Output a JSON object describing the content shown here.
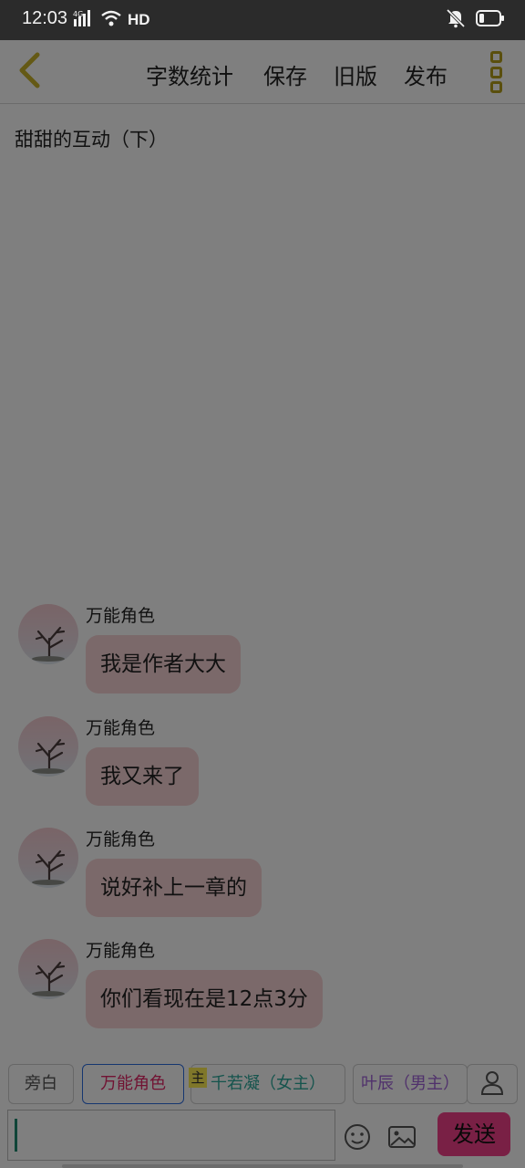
{
  "status_bar": {
    "time": "12:03",
    "network": "4G",
    "hd": "HD",
    "icons": [
      "signal-icon",
      "wifi-icon",
      "mute-icon",
      "battery-icon"
    ]
  },
  "toolbar": {
    "back_icon": "chevron-left-icon",
    "word_count": "字数统计",
    "save": "保存",
    "old_version": "旧版",
    "publish": "发布",
    "more_icon": "more-vertical-icon"
  },
  "chapter": {
    "title": "甜甜的互动（下）"
  },
  "messages": [
    {
      "sender": "万能角色",
      "text": "我是作者大大",
      "avatar": "tree-avatar"
    },
    {
      "sender": "万能角色",
      "text": "我又来了",
      "avatar": "tree-avatar"
    },
    {
      "sender": "万能角色",
      "text": "说好补上一章的",
      "avatar": "tree-avatar"
    },
    {
      "sender": "万能角色",
      "text": "你们看现在是12点3分",
      "avatar": "tree-avatar"
    }
  ],
  "roles": [
    {
      "label": "旁白"
    },
    {
      "label": "万能角色",
      "selected": true
    },
    {
      "label": "千若凝（女主）",
      "tag": "主"
    },
    {
      "label": "叶辰（男主）"
    }
  ],
  "input": {
    "value": "",
    "send": "发送"
  },
  "colors": {
    "accent_gold": "#b59e1b",
    "bubble": "#f7d2d4",
    "send_button": "#f2418a",
    "universal_role": "#e32767",
    "heroine_role": "#2aa89a",
    "hero_role": "#a062d8"
  }
}
